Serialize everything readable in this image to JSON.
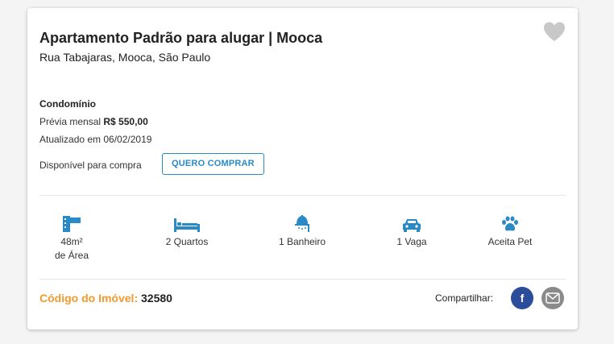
{
  "listing": {
    "title": "Apartamento Padrão para alugar | Mooca",
    "address": "Rua Tabajaras, Mooca, São Paulo",
    "favorite_icon": "heart-icon"
  },
  "condominium": {
    "label": "Condomínio",
    "preview_prefix": "Prévia mensal",
    "preview_value": "R$ 550,00",
    "updated": "Atualizado em 06/02/2019",
    "availability": "Disponível para compra",
    "buy_button": "QUERO COMPRAR"
  },
  "features": [
    {
      "icon": "area-icon",
      "line1": "48m²",
      "line2": "de Área"
    },
    {
      "icon": "bed-icon",
      "line1": "2 Quartos",
      "line2": ""
    },
    {
      "icon": "shower-icon",
      "line1": "1 Banheiro",
      "line2": ""
    },
    {
      "icon": "car-icon",
      "line1": "1 Vaga",
      "line2": ""
    },
    {
      "icon": "paw-icon",
      "line1": "Aceita Pet",
      "line2": ""
    }
  ],
  "footer": {
    "code_label": "Código do Imóvel:",
    "code_value": "32580",
    "share_label": "Compartilhar:",
    "facebook_glyph": "f"
  },
  "colors": {
    "accent_blue": "#2a8ac7",
    "code_orange": "#f29a2e",
    "facebook": "#2b4d9a",
    "email_gray": "#8a8a8a",
    "heart_gray": "#c8c8c8"
  }
}
